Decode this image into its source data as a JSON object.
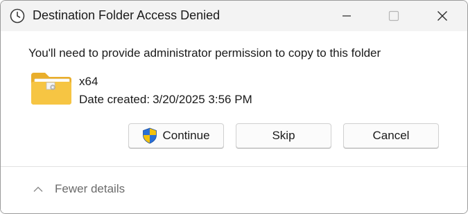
{
  "window": {
    "title": "Destination Folder Access Denied",
    "icon": "clock-icon"
  },
  "titlebar": {
    "minimize_icon": "minimize-icon",
    "maximize_icon": "maximize-icon",
    "close_icon": "close-icon"
  },
  "message": "You'll need to provide administrator permission to copy to this folder",
  "item": {
    "icon": "folder-icon",
    "name": "x64",
    "date_label": "Date created:",
    "date_value": "3/20/2025 3:56 PM"
  },
  "buttons": {
    "continue_label": "Continue",
    "continue_icon": "uac-shield-icon",
    "skip_label": "Skip",
    "cancel_label": "Cancel"
  },
  "footer": {
    "details_label": "Fewer details",
    "details_icon": "chevron-up-icon"
  },
  "colors": {
    "titlebar_bg": "#f3f3f3",
    "folder_yellow": "#f6c543",
    "shield_blue": "#2a6fd6",
    "shield_yellow": "#f4c20d",
    "muted_text": "#6b6b6b"
  }
}
